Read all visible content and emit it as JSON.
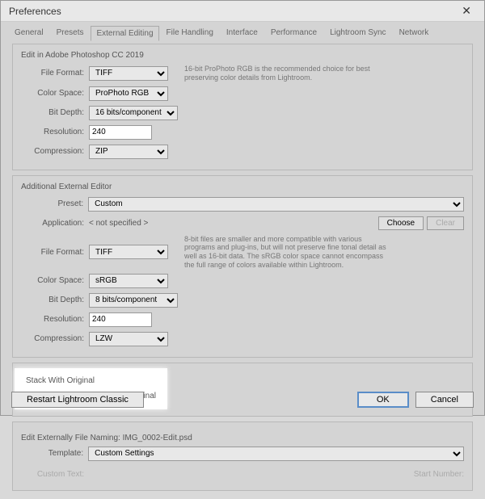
{
  "window": {
    "title": "Preferences"
  },
  "tabs": [
    "General",
    "Presets",
    "External Editing",
    "File Handling",
    "Interface",
    "Performance",
    "Lightroom Sync",
    "Network"
  ],
  "active_tab": 2,
  "section1": {
    "title": "Edit in Adobe Photoshop CC 2019",
    "file_format_label": "File Format:",
    "file_format_value": "TIFF",
    "color_space_label": "Color Space:",
    "color_space_value": "ProPhoto RGB",
    "bit_depth_label": "Bit Depth:",
    "bit_depth_value": "16 bits/component",
    "resolution_label": "Resolution:",
    "resolution_value": "240",
    "compression_label": "Compression:",
    "compression_value": "ZIP",
    "desc": "16-bit ProPhoto RGB is the recommended choice for best preserving color details from Lightroom."
  },
  "section2": {
    "title": "Additional External Editor",
    "preset_label": "Preset:",
    "preset_value": "Custom",
    "application_label": "Application:",
    "application_value": "< not specified >",
    "choose_btn": "Choose",
    "clear_btn": "Clear",
    "file_format_label": "File Format:",
    "file_format_value": "TIFF",
    "color_space_label": "Color Space:",
    "color_space_value": "sRGB",
    "bit_depth_label": "Bit Depth:",
    "bit_depth_value": "8 bits/component",
    "resolution_label": "Resolution:",
    "resolution_value": "240",
    "compression_label": "Compression:",
    "compression_value": "LZW",
    "desc": "8-bit files are smaller and more compatible with various programs and plug-ins, but will not preserve fine tonal detail as well as 16-bit data. The sRGB color space cannot encompass the full range of colors available within Lightroom."
  },
  "stack": {
    "title": "Stack With Original",
    "checkbox_label": "Stack With Original"
  },
  "naming": {
    "title_prefix": "Edit Externally File Naming:",
    "title_value": "IMG_0002-Edit.psd",
    "template_label": "Template:",
    "template_value": "Custom Settings",
    "custom_text_label": "Custom Text:",
    "start_number_label": "Start Number:"
  },
  "footer": {
    "restart_btn": "Restart Lightroom Classic",
    "ok_btn": "OK",
    "cancel_btn": "Cancel"
  }
}
